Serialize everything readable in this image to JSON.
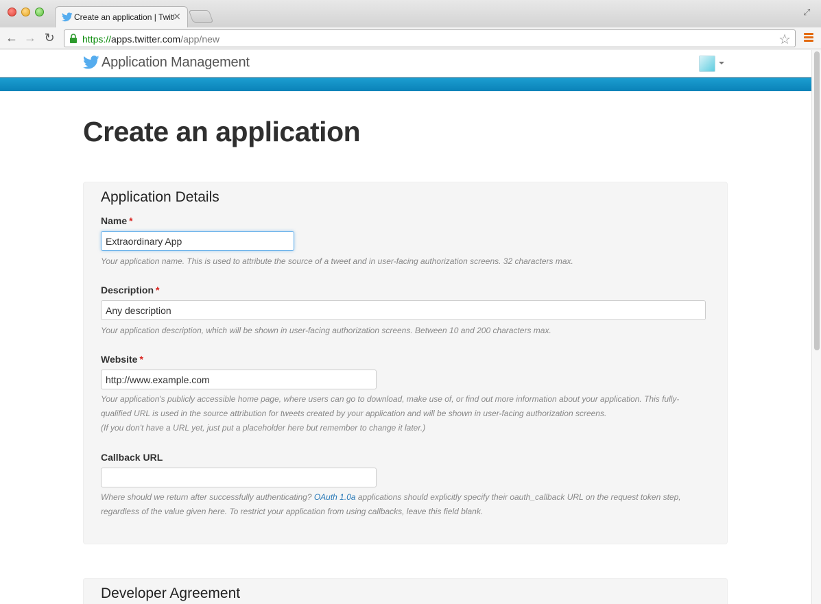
{
  "browser": {
    "tab_title": "Create an application | Twitter",
    "url_scheme": "https://",
    "url_host": "apps.twitter.com",
    "url_path": "/app/new"
  },
  "header": {
    "app_title": "Application Management",
    "accent_color": "#1b9dd0"
  },
  "main": {
    "page_title": "Create an application",
    "details_heading": "Application Details",
    "fields": {
      "name": {
        "label": "Name",
        "required": "*",
        "value": "Extraordinary App",
        "help": "Your application name. This is used to attribute the source of a tweet and in user-facing authorization screens. 32 characters max."
      },
      "description": {
        "label": "Description",
        "required": "*",
        "value": "Any description",
        "help": "Your application description, which will be shown in user-facing authorization screens. Between 10 and 200 characters max."
      },
      "website": {
        "label": "Website",
        "required": "*",
        "value": "http://www.example.com",
        "help_line1": "Your application's publicly accessible home page, where users can go to download, make use of, or find out more information about your application. This fully-qualified URL is used in the source attribution for tweets created by your application and will be shown in user-facing authorization screens.",
        "help_line2": "(If you don't have a URL yet, just put a placeholder here but remember to change it later.)"
      },
      "callback": {
        "label": "Callback URL",
        "value": "",
        "help_pre": "Where should we return after successfully authenticating? ",
        "help_link": "OAuth 1.0a",
        "help_post": " applications should explicitly specify their oauth_callback URL on the request token step, regardless of the value given here. To restrict your application from using callbacks, leave this field blank."
      }
    },
    "agreement_heading": "Developer Agreement"
  }
}
